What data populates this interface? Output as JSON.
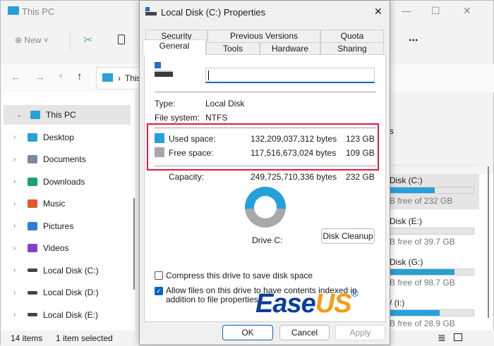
{
  "explorer": {
    "title": "This PC",
    "toolbar": {
      "new_label": "New",
      "more_label": "..."
    },
    "address": "This",
    "sidebar": [
      {
        "label": "This PC",
        "icon": "monitor-icon",
        "expanded": true,
        "selected": true
      },
      {
        "label": "Desktop",
        "icon": "desktop-folder-icon"
      },
      {
        "label": "Documents",
        "icon": "documents-icon"
      },
      {
        "label": "Downloads",
        "icon": "downloads-icon"
      },
      {
        "label": "Music",
        "icon": "music-icon"
      },
      {
        "label": "Pictures",
        "icon": "pictures-icon"
      },
      {
        "label": "Videos",
        "icon": "videos-icon"
      },
      {
        "label": "Local Disk (C:)",
        "icon": "drive-icon"
      },
      {
        "label": "Local Disk (D:)",
        "icon": "drive-icon"
      },
      {
        "label": "Local Disk (E:)",
        "icon": "drive-icon"
      }
    ],
    "pane_heading_fragment": "s",
    "drives": [
      {
        "name": "Disk (C:)",
        "free": "B free of 232 GB",
        "used_fraction": 0.53,
        "selected": true
      },
      {
        "name": "Disk (E:)",
        "free": "B free of 39.7 GB",
        "used_fraction": 0.0
      },
      {
        "name": "Disk (G:)",
        "free": "B free of 98.7 GB",
        "used_fraction": 0.77
      },
      {
        "name": "/ (I:)",
        "free": "B free of 28.9 GB",
        "used_fraction": 0.59
      }
    ],
    "status": {
      "items": "14 items",
      "selected": "1 item selected"
    }
  },
  "dialog": {
    "title": "Local Disk (C:) Properties",
    "tabs_row1": [
      "Security",
      "Previous Versions",
      "Quota"
    ],
    "tabs_row2": [
      "General",
      "Tools",
      "Hardware",
      "Sharing"
    ],
    "active_tab": "General",
    "name_value": "",
    "type_label": "Type:",
    "type_value": "Local Disk",
    "fs_label": "File system:",
    "fs_value": "NTFS",
    "used": {
      "label": "Used space:",
      "bytes": "132,209,037,312 bytes",
      "size": "123 GB"
    },
    "free": {
      "label": "Free space:",
      "bytes": "117,516,673,024 bytes",
      "size": "109 GB"
    },
    "capacity": {
      "label": "Capacity:",
      "bytes": "249,725,710,336 bytes",
      "size": "232 GB"
    },
    "used_fraction": 0.53,
    "drive_label": "Drive C:",
    "cleanup_label": "Disk Cleanup",
    "compress_label": "Compress this drive to save disk space",
    "compress_checked": false,
    "index_label": "Allow files on this drive to have contents indexed in addition to file properties",
    "index_checked": true,
    "ok": "OK",
    "cancel": "Cancel",
    "apply": "Apply"
  },
  "colors": {
    "used": "#26a0da",
    "free": "#a8a8a8",
    "highlight": "#e8173f",
    "accent": "#0067c0"
  },
  "watermark": {
    "text": "EaseUS"
  }
}
